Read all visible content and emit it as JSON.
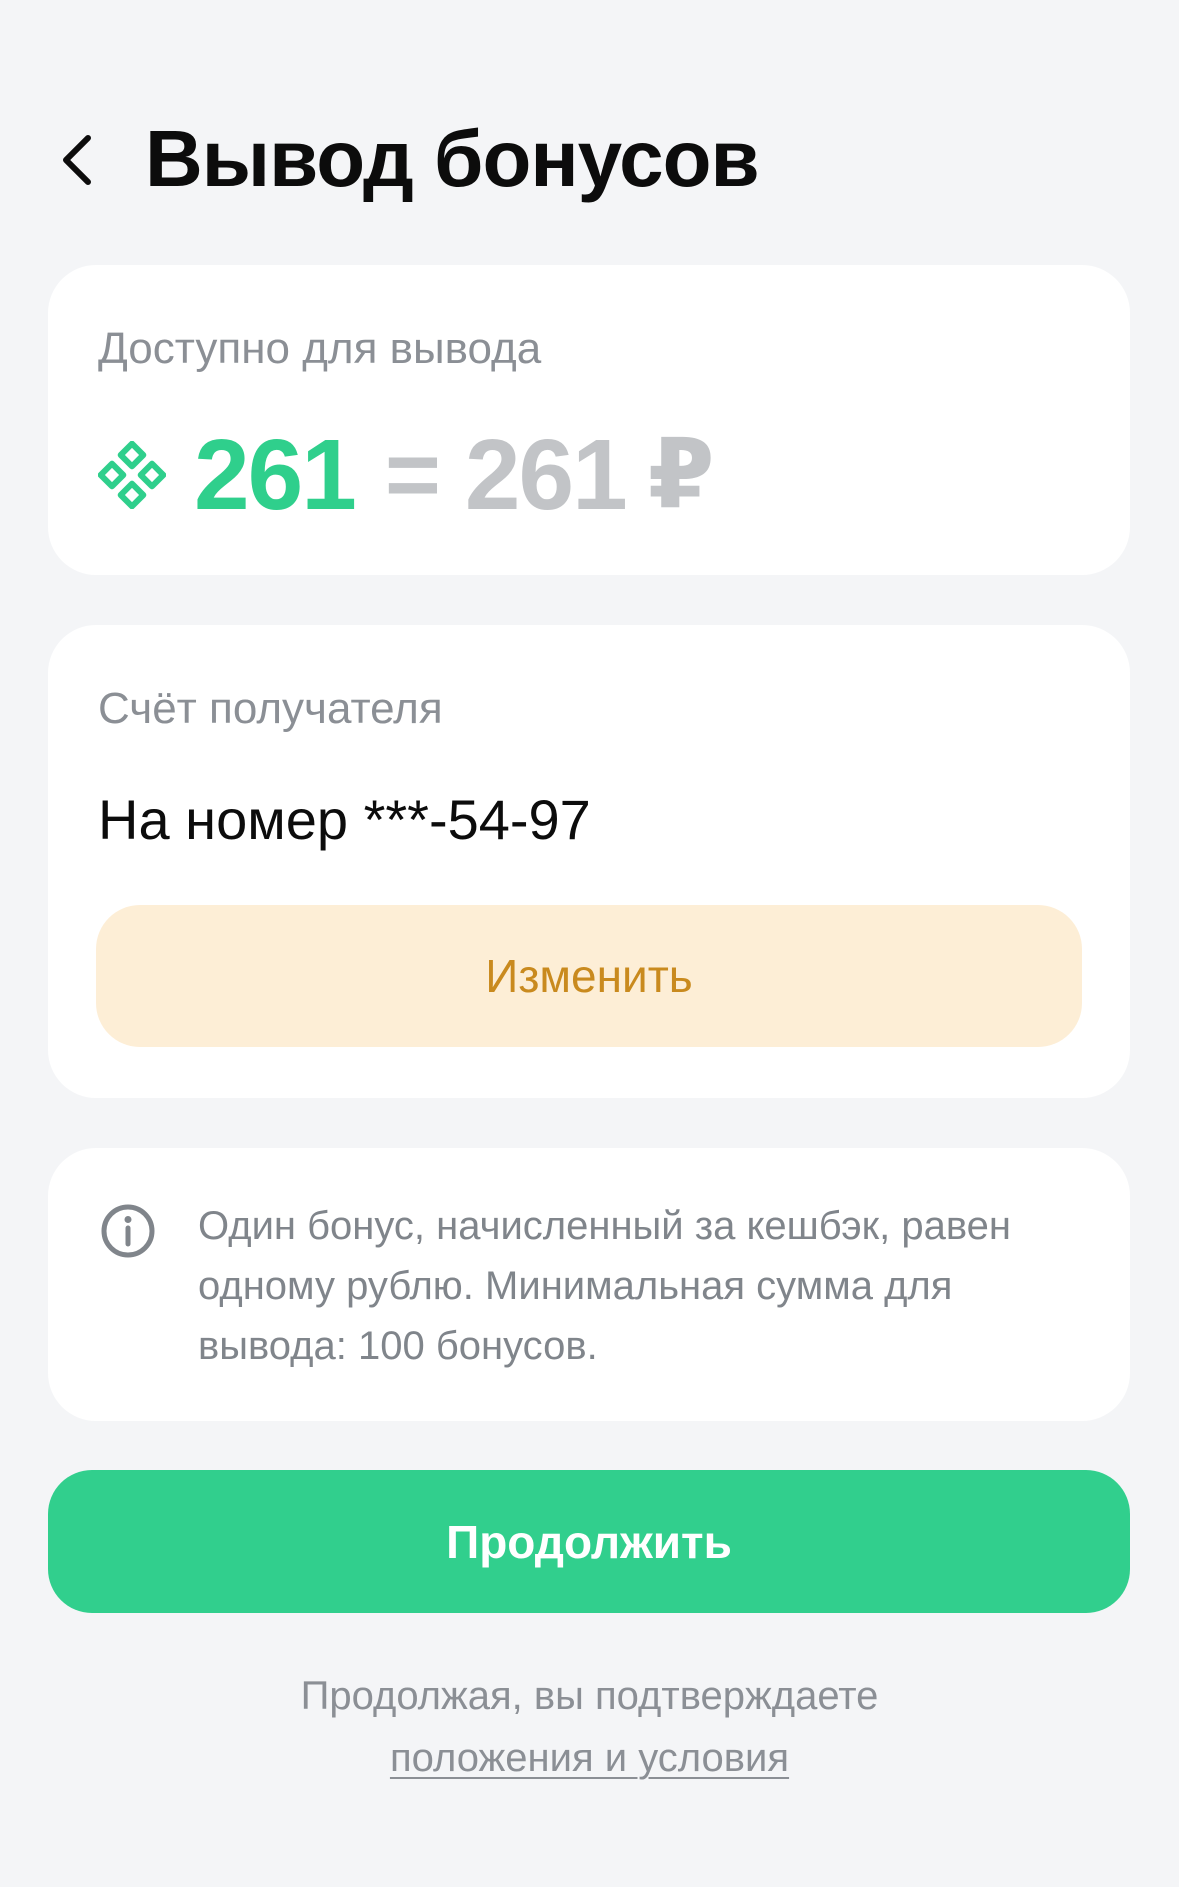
{
  "header": {
    "back_icon": "chevron-left-icon",
    "title": "Вывод бонусов"
  },
  "balance": {
    "label": "Доступно для вывода",
    "bonus_icon": "bonus-diamond-icon",
    "bonus_amount": "261",
    "equals": "=",
    "rub_amount": "261",
    "currency": "₽",
    "accent_color": "#2fcf8c"
  },
  "account": {
    "label": "Счёт получателя",
    "value": "На номер ***-54-97",
    "change_label": "Изменить"
  },
  "info": {
    "icon": "info-icon",
    "text": "Один бонус, начисленный за кешбэк, равен одному рублю. Минимальная сумма для вывода: 100 бонусов."
  },
  "actions": {
    "continue_label": "Продолжить",
    "continue_color": "#31cf8d"
  },
  "footer": {
    "text": "Продолжая, вы подтверждаете",
    "link": "положения и условия"
  }
}
